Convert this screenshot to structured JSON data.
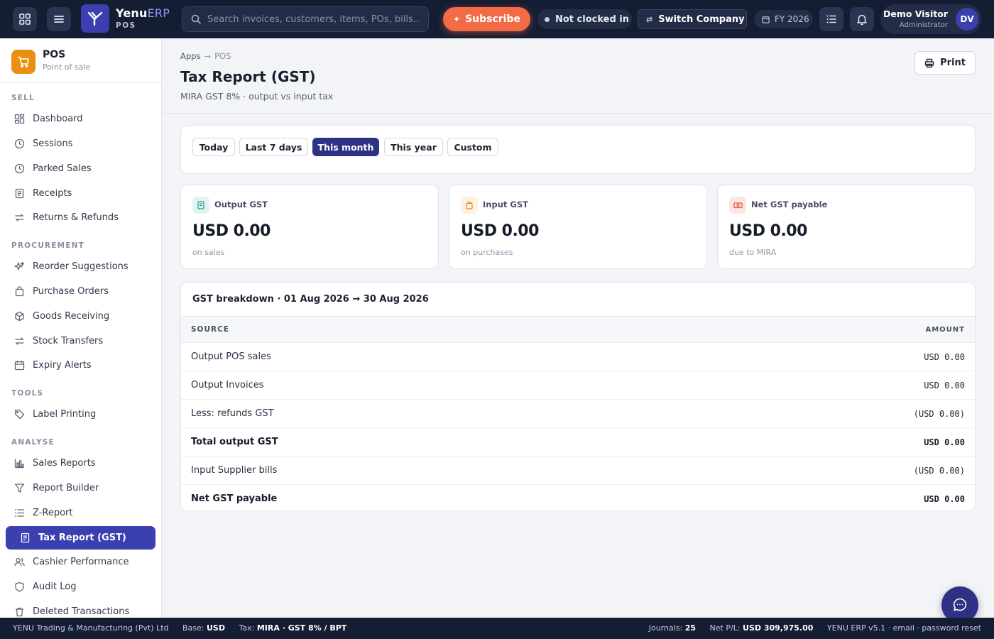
{
  "topbar": {
    "brand_name_1": "Yenu",
    "brand_name_2": "ERP",
    "brand_sub": "POS",
    "search_placeholder": "Search invoices, customers, items, POs, bills…",
    "subscribe_label": "Subscribe",
    "clock_status": "Not clocked in",
    "switch_company_label": "Switch Company",
    "fiscal_year": "FY 2026",
    "user_name": "Demo Visitor",
    "user_role": "Administrator",
    "user_initials": "DV",
    "colors": {
      "bar": "#151d33",
      "subscribe": "#f26b46",
      "brand": "#3b3fb0"
    }
  },
  "sidebar": {
    "app_title": "POS",
    "app_subtitle": "Point of sale",
    "sections": [
      "SELL",
      "PROCUREMENT",
      "TOOLS",
      "ANALYSE"
    ],
    "items": [
      {
        "label": "Dashboard",
        "icon": "dashboard-icon"
      },
      {
        "label": "Sessions",
        "icon": "clock-icon"
      },
      {
        "label": "Parked Sales",
        "icon": "clock-icon"
      },
      {
        "label": "Receipts",
        "icon": "receipt-icon"
      },
      {
        "label": "Returns & Refunds",
        "icon": "swap-icon"
      },
      {
        "label": "Reorder Suggestions",
        "icon": "sparkle-icon"
      },
      {
        "label": "Purchase Orders",
        "icon": "bag-icon"
      },
      {
        "label": "Goods Receiving",
        "icon": "box-icon"
      },
      {
        "label": "Stock Transfers",
        "icon": "swap-icon"
      },
      {
        "label": "Expiry Alerts",
        "icon": "calendar-icon"
      },
      {
        "label": "Label Printing",
        "icon": "tag-icon"
      },
      {
        "label": "Sales Reports",
        "icon": "bar-chart-icon"
      },
      {
        "label": "Report Builder",
        "icon": "filter-icon"
      },
      {
        "label": "Z-Report",
        "icon": "list-icon"
      },
      {
        "label": "Tax Report (GST)",
        "icon": "receipt-icon",
        "active": true
      },
      {
        "label": "Cashier Performance",
        "icon": "users-icon"
      },
      {
        "label": "Audit Log",
        "icon": "shield-icon"
      },
      {
        "label": "Deleted Transactions",
        "icon": "trash-icon"
      }
    ]
  },
  "page": {
    "breadcrumb_root": "Apps",
    "breadcrumb_current": "POS",
    "title": "Tax Report (GST)",
    "subtitle": "MIRA GST 8% · output vs input tax",
    "print_label": "Print"
  },
  "ranges": {
    "options": [
      "Today",
      "Last 7 days",
      "This month",
      "This year",
      "Custom"
    ],
    "selected": "This month"
  },
  "kpis": [
    {
      "label": "Output GST",
      "value": "USD 0.00",
      "note": "on sales",
      "icon": "receipt-icon",
      "color": "#2a9d8f"
    },
    {
      "label": "Input GST",
      "value": "USD 0.00",
      "note": "on purchases",
      "icon": "bag-icon",
      "color": "#e08a1e"
    },
    {
      "label": "Net GST payable",
      "value": "USD 0.00",
      "note": "due to MIRA",
      "icon": "money-icon",
      "color": "#e0543a"
    }
  ],
  "breakdown": {
    "title_prefix": "GST breakdown ·",
    "date_from": "01 Aug 2026",
    "arrow": "→",
    "date_to": "30 Aug 2026",
    "col_source": "SOURCE",
    "col_amount": "AMOUNT",
    "rows": [
      {
        "source": "Output POS sales",
        "amount": "USD 0.00",
        "bold": false
      },
      {
        "source": "Output Invoices",
        "amount": "USD 0.00",
        "bold": false
      },
      {
        "source": "Less: refunds GST",
        "amount": "(USD 0.00)",
        "bold": false
      },
      {
        "source": "Total output GST",
        "amount": "USD 0.00",
        "bold": true
      },
      {
        "source": "Input Supplier bills",
        "amount": "(USD 0.00)",
        "bold": false
      },
      {
        "source": "Net GST payable",
        "amount": "USD 0.00",
        "bold": true
      }
    ]
  },
  "footer": {
    "company": "YENU Trading & Manufacturing (Pvt) Ltd",
    "base_label": "Base:",
    "base_value": "USD",
    "tax_label": "Tax:",
    "tax_value": "MIRA · GST 8% / BPT",
    "journals_label": "Journals:",
    "journals_value": "25",
    "netpl_label": "Net P/L:",
    "netpl_value": "USD 309,975.00",
    "version_text": "YENU ERP v5.1 · email · password reset"
  }
}
